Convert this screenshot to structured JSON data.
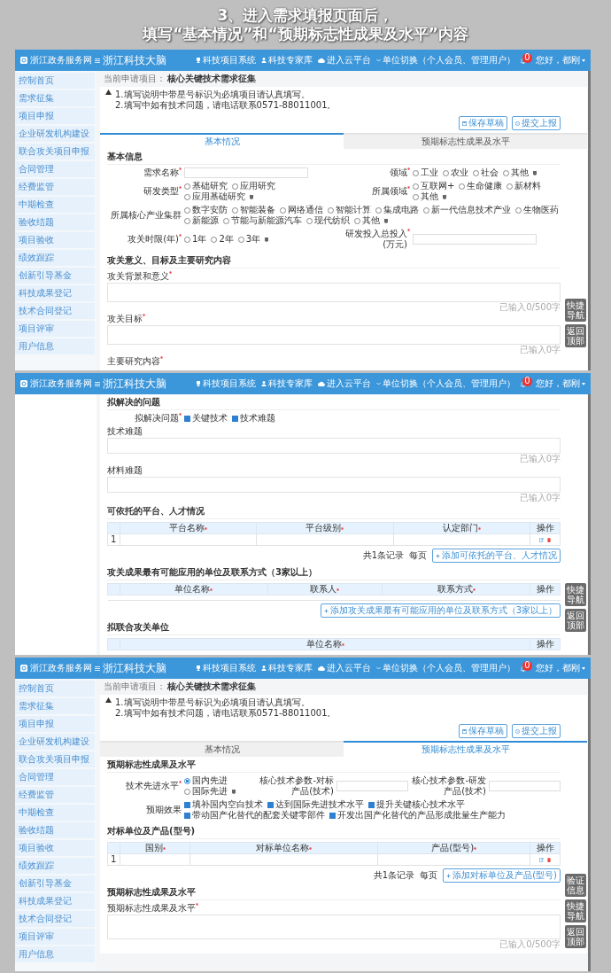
{
  "heading": {
    "lines": [
      "3、进入需求填报页面后，",
      "填写“基本情况”和“预期标志性成果及水平”内容"
    ]
  },
  "screens": [
    {
      "header": {
        "logo": "浙江政务服务网",
        "title": "浙江科技大脑",
        "links": [
          {
            "kind": "trophy",
            "label": "科技项目系统"
          },
          {
            "kind": "person",
            "label": "科技专家库"
          },
          {
            "kind": "cloud",
            "label": "进入云平台"
          }
        ],
        "account": "单位切换（个人会员、管理用户）",
        "badge": "0",
        "user": "您好，都刚"
      },
      "sidebar": {
        "items": [
          "控制首页",
          "需求征集",
          "项目申报",
          "企业研发机构建设",
          "联合攻关项目申报",
          "合同管理",
          "经费监管",
          "中期检查",
          "验收结题",
          "项目验收",
          "绩效跟踪",
          "创新引导基金",
          "科技成果登记",
          "技术合同登记",
          "项目评审",
          "用户信息"
        ]
      },
      "breadcrumb": {
        "label": "当前申请项目：",
        "project": "核心关键技术需求征集"
      },
      "notice": [
        "1.填写说明中带星号标识为必填项目请认真填写。",
        "2.填写中如有技术问题，请电话联系0571-88011001。"
      ],
      "actions": [
        {
          "kind": "save",
          "label": "保存草稿"
        },
        {
          "kind": "submit",
          "label": "提交上报"
        }
      ],
      "tabs": [
        {
          "label": "基本情况",
          "selected": true
        },
        {
          "label": "预期标志性成果及水平",
          "selected": false
        }
      ],
      "sections": [
        {
          "title": "基本信息",
          "blocks": [
            {
              "kind": "fields",
              "fields": [
                {
                  "label": "需求名称",
                  "required": true,
                  "kind": "text"
                },
                {
                  "label": "领域",
                  "required": true,
                  "kind": "radio",
                  "help": true,
                  "options": [
                    {
                      "label": "工业",
                      "selected": false
                    },
                    {
                      "label": "农业",
                      "selected": false
                    },
                    {
                      "label": "社会",
                      "selected": false
                    },
                    {
                      "label": "其他",
                      "selected": false
                    }
                  ]
                }
              ]
            },
            {
              "kind": "fields",
              "fields": [
                {
                  "label": "研发类型",
                  "required": true,
                  "kind": "radio",
                  "help": true,
                  "options": [
                    {
                      "label": "基础研究",
                      "selected": false
                    },
                    {
                      "label": "应用研究",
                      "selected": false
                    },
                    {
                      "label": "应用基础研究",
                      "selected": false
                    }
                  ]
                },
                {
                  "label": "所属领域",
                  "required": true,
                  "kind": "radio",
                  "help": true,
                  "options": [
                    {
                      "label": "互联网+",
                      "selected": false
                    },
                    {
                      "label": "生命健康",
                      "selected": false
                    },
                    {
                      "label": "新材料",
                      "selected": false
                    },
                    {
                      "label": "其他",
                      "selected": false
                    }
                  ]
                }
              ]
            },
            {
              "kind": "fields",
              "fields": [
                {
                  "label": "所属核心产业集群",
                  "required": false,
                  "kind": "radio",
                  "help": true,
                  "options": [
                    {
                      "label": "数字安防",
                      "selected": false
                    },
                    {
                      "label": "智能装备",
                      "selected": false
                    },
                    {
                      "label": "网络通信",
                      "selected": false
                    },
                    {
                      "label": "智能计算",
                      "selected": false
                    },
                    {
                      "label": "集成电路",
                      "selected": false
                    },
                    {
                      "label": "新一代信息技术产业",
                      "selected": false
                    },
                    {
                      "label": "生物医药",
                      "selected": false
                    },
                    {
                      "label": "新能源",
                      "selected": false
                    },
                    {
                      "label": "节能与新能源汽车",
                      "selected": false
                    },
                    {
                      "label": "现代纺织",
                      "selected": false
                    },
                    {
                      "label": "其他",
                      "selected": false
                    }
                  ]
                }
              ]
            },
            {
              "kind": "fields",
              "fields": [
                {
                  "label": "攻关时限(年)",
                  "required": true,
                  "kind": "radio",
                  "help": true,
                  "options": [
                    {
                      "label": "1年",
                      "selected": false
                    },
                    {
                      "label": "2年",
                      "selected": false
                    },
                    {
                      "label": "3年",
                      "selected": false
                    }
                  ]
                },
                {
                  "label": "研发投入总投入(万元)",
                  "required": true,
                  "kind": "text"
                }
              ]
            }
          ]
        },
        {
          "title": "攻关意义、目标及主要研究内容",
          "blocks": [
            {
              "kind": "textarea",
              "label": "攻关背景和意义",
              "required": true,
              "counter": "已输入0/500字"
            },
            {
              "kind": "textarea",
              "label": "攻关目标",
              "required": true,
              "counter": "已输入0字"
            },
            {
              "kind": "label",
              "label": "主要研究内容",
              "required": true
            }
          ]
        }
      ],
      "float_buttons": [
        "快捷导航",
        "返回顶部"
      ]
    },
    {
      "header": {
        "logo": "浙江政务服务网",
        "title": "浙江科技大脑",
        "links": [
          {
            "kind": "trophy",
            "label": "科技项目系统"
          },
          {
            "kind": "person",
            "label": "科技专家库"
          },
          {
            "kind": "cloud",
            "label": "进入云平台"
          }
        ],
        "account": "单位切换（个人会员、管理用户）",
        "badge": "0",
        "user": "您好，都刚"
      },
      "sections": [
        {
          "title": "拟解决的问题",
          "blocks": [
            {
              "kind": "fields",
              "fields": [
                {
                  "label": "拟解决问题",
                  "required": true,
                  "kind": "check",
                  "options": [
                    {
                      "label": "关键技术",
                      "checked": true
                    },
                    {
                      "label": "技术难题",
                      "checked": true
                    }
                  ]
                }
              ]
            },
            {
              "kind": "textarea",
              "label": "技术难题",
              "required": false,
              "counter": "已输入0字"
            },
            {
              "kind": "textarea",
              "label": "材料难题",
              "required": false,
              "counter": "已输入0字"
            }
          ]
        },
        {
          "title": "可依托的平台、人才情况",
          "blocks": [
            {
              "kind": "table",
              "columns": [
                {
                  "label": "平台名称",
                  "required": true
                },
                {
                  "label": "平台级别",
                  "required": true
                },
                {
                  "label": "认定部门",
                  "required": true
                },
                {
                  "label": "操作",
                  "required": false
                }
              ],
              "rows": [
                {
                  "index": "1"
                }
              ],
              "footer": {
                "total": "共1条记录",
                "page_size": "每页"
              },
              "add_button": "添加可依托的平台、人才情况"
            }
          ]
        },
        {
          "title": "攻关成果最有可能应用的单位及联系方式（3家以上）",
          "blocks": [
            {
              "kind": "table",
              "columns": [
                {
                  "label": "单位名称",
                  "required": true
                },
                {
                  "label": "联系人",
                  "required": true
                },
                {
                  "label": "联系方式",
                  "required": true
                },
                {
                  "label": "操作",
                  "required": false
                }
              ],
              "add_button": "添加攻关成果最有可能应用的单位及联系方式（3家以上）"
            }
          ]
        },
        {
          "title": "拟联合攻关单位",
          "blocks": [
            {
              "kind": "table",
              "columns": [
                {
                  "label": "单位名称",
                  "required": true
                },
                {
                  "label": "操作",
                  "required": false
                }
              ]
            }
          ]
        }
      ],
      "float_buttons": [
        "快捷导航",
        "返回顶部"
      ]
    },
    {
      "header": {
        "logo": "浙江政务服务网",
        "title": "浙江科技大脑",
        "links": [
          {
            "kind": "trophy",
            "label": "科技项目系统"
          },
          {
            "kind": "person",
            "label": "科技专家库"
          },
          {
            "kind": "cloud",
            "label": "进入云平台"
          }
        ],
        "account": "单位切换（个人会员、管理用户）",
        "badge": "0",
        "user": "您好，都刚"
      },
      "sidebar": {
        "items": [
          "控制首页",
          "需求征集",
          "项目申报",
          "企业研发机构建设",
          "联合攻关项目申报",
          "合同管理",
          "经费监管",
          "中期检查",
          "验收结题",
          "项目验收",
          "绩效跟踪",
          "创新引导基金",
          "科技成果登记",
          "技术合同登记",
          "项目评审",
          "用户信息"
        ]
      },
      "breadcrumb": {
        "label": "当前申请项目：",
        "project": "核心关键技术需求征集"
      },
      "notice": [
        "1.填写说明中带星号标识为必填项目请认真填写。",
        "2.填写中如有技术问题，请电话联系0571-88011001。"
      ],
      "actions": [
        {
          "kind": "save",
          "label": "保存草稿"
        },
        {
          "kind": "submit",
          "label": "提交上报"
        }
      ],
      "tabs": [
        {
          "label": "基本情况",
          "selected": false
        },
        {
          "label": "预期标志性成果及水平",
          "selected": true
        }
      ],
      "sections": [
        {
          "title": "预期标志性成果及水平",
          "blocks": [
            {
              "kind": "fields",
              "fields": [
                {
                  "label": "技术先进水平",
                  "required": true,
                  "kind": "radio",
                  "help": true,
                  "options": [
                    {
                      "label": "国内先进",
                      "selected": true
                    },
                    {
                      "label": "国际先进",
                      "selected": false
                    }
                  ]
                },
                {
                  "label": "核心技术参数-对标产品(技术)",
                  "required": false,
                  "kind": "text"
                },
                {
                  "label": "核心技术参数-研发产品(技术)",
                  "required": false,
                  "kind": "text"
                }
              ]
            },
            {
              "kind": "fields",
              "fields": [
                {
                  "label": "预期效果",
                  "required": false,
                  "kind": "check",
                  "options": [
                    {
                      "label": "填补国内空白技术",
                      "checked": true
                    },
                    {
                      "label": "达到国际先进技术水平",
                      "checked": true
                    },
                    {
                      "label": "提升关键核心技术水平",
                      "checked": true
                    },
                    {
                      "label": "带动国产化替代的配套关键零部件",
                      "checked": true
                    },
                    {
                      "label": "开发出国产化替代的产品形成批量生产能力",
                      "checked": true
                    }
                  ]
                }
              ]
            }
          ]
        },
        {
          "title": "对标单位及产品(型号)",
          "blocks": [
            {
              "kind": "table",
              "columns": [
                {
                  "label": "国别",
                  "required": true
                },
                {
                  "label": "对标单位名称",
                  "required": true
                },
                {
                  "label": "产品(型号)",
                  "required": true
                },
                {
                  "label": "操作",
                  "required": false
                }
              ],
              "rows": [
                {
                  "index": "1"
                }
              ],
              "footer": {
                "total": "共1条记录",
                "page_size": "每页"
              },
              "add_button": "添加对标单位及产品(型号)"
            }
          ]
        },
        {
          "title": "预期标志性成果及水平",
          "blocks": [
            {
              "kind": "textarea",
              "label": "预期标志性成果及水平",
              "required": true,
              "counter": "已输入0/500字",
              "tall": true
            }
          ]
        }
      ],
      "float_buttons": [
        "验证信息",
        "快捷导航",
        "返回顶部"
      ]
    }
  ]
}
